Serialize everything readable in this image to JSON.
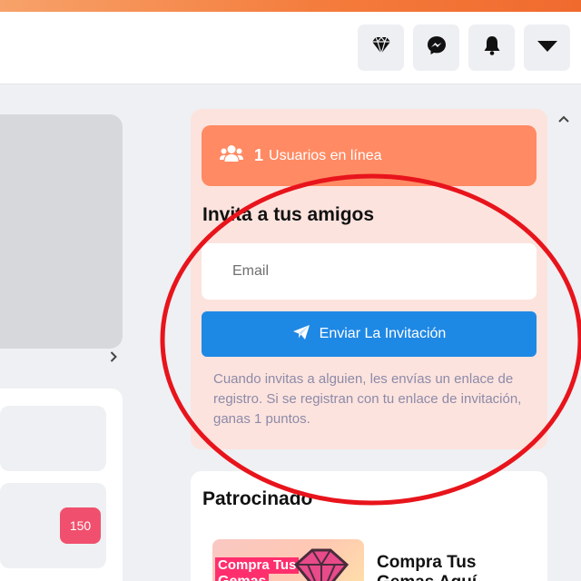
{
  "header": {
    "icons": [
      "diamond-icon",
      "messenger-icon",
      "bell-icon",
      "caret-down-icon"
    ]
  },
  "left": {
    "badge_count": "150"
  },
  "invite": {
    "online_count": "1",
    "online_label": "Usuarios en línea",
    "title": "Invita a tus amigos",
    "email_placeholder": "Email",
    "send_label": "Enviar La Invitación",
    "note": "Cuando invitas a alguien, les envías un enlace de registro. Si se registran con tu enlace de invitación, ganas 1 puntos."
  },
  "sponsored": {
    "title": "Patrocinado",
    "ad_image_text_1": "Compra Tus",
    "ad_image_text_2": "Gemas",
    "ad_title_1": "Compra Tus",
    "ad_title_2": "Gemas Aquí"
  },
  "colors": {
    "accent_orange": "#ff8a63",
    "button_blue": "#1e88e5",
    "badge_red": "#f0506e",
    "annotation_red": "#e8141c"
  }
}
